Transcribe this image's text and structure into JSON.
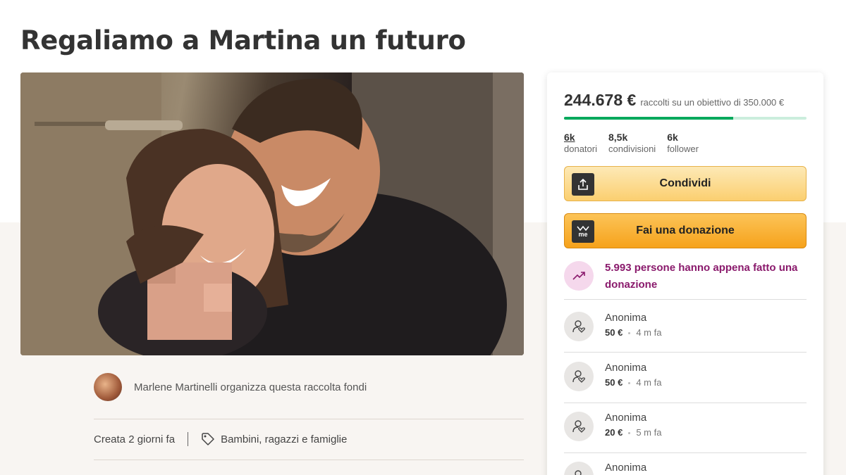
{
  "campaign": {
    "title": "Regaliamo a Martina un futuro",
    "organizer_text": "Marlene Martinelli organizza questa raccolta fondi",
    "created": "Creata 2 giorni fa",
    "category": "Bambini, ragazzi e famiglie"
  },
  "donation_card": {
    "raised_amount": "244.678 €",
    "goal_text": "raccolti su un obiettivo di 350.000 €",
    "progress_fraction": 0.699,
    "stats": [
      {
        "value": "6k",
        "label": "donatori"
      },
      {
        "value": "8,5k",
        "label": "condivisioni"
      },
      {
        "value": "6k",
        "label": "follower"
      }
    ],
    "share_label": "Condividi",
    "donate_label": "Fai una donazione",
    "donate_icon_text": "me",
    "recent_text": "5.993 persone hanno appena fatto una donazione",
    "donations": [
      {
        "name": "Anonima",
        "amount": "50 €",
        "time": "4 m fa"
      },
      {
        "name": "Anonima",
        "amount": "50 €",
        "time": "4 m fa"
      },
      {
        "name": "Anonima",
        "amount": "20 €",
        "time": "5 m fa"
      },
      {
        "name": "Anonima"
      }
    ]
  },
  "colors": {
    "progress": "#02a95c",
    "share_button": "#fbcf70",
    "donate_button": "#f6a21b",
    "recent_text": "#8a1a6c"
  }
}
